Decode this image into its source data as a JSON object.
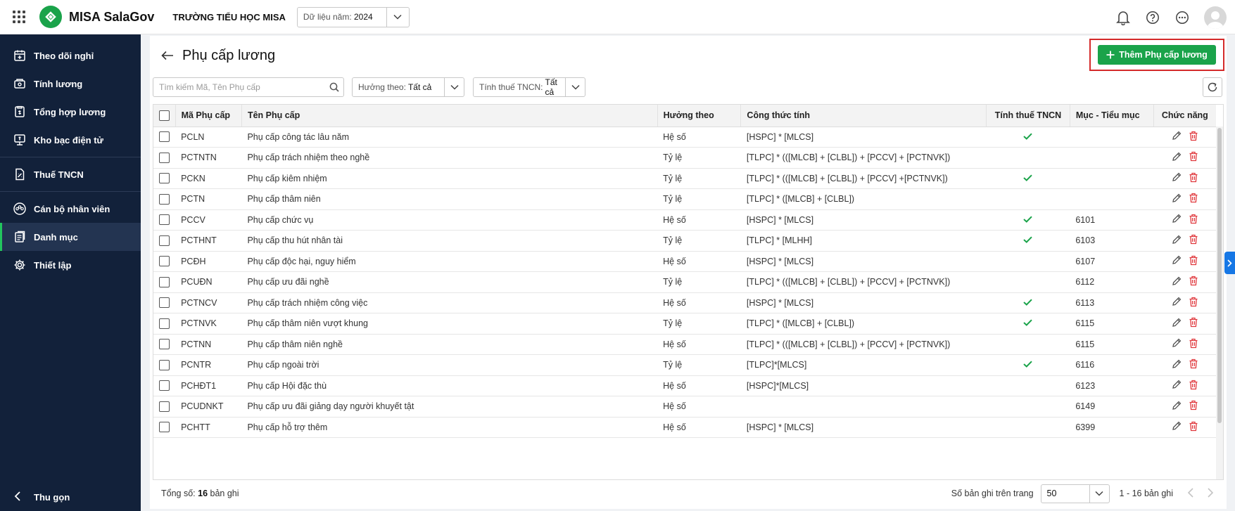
{
  "header": {
    "app_name": "MISA SalaGov",
    "school": "TRƯỜNG TIỂU HỌC MISA",
    "year_label": "Dữ liệu năm:",
    "year_value": "2024"
  },
  "sidebar": {
    "items": [
      {
        "label": "Theo dõi nghỉ",
        "icon": "calendar-icon"
      },
      {
        "label": "Tính lương",
        "icon": "salary-icon"
      },
      {
        "label": "Tổng hợp lương",
        "icon": "summary-icon"
      },
      {
        "label": "Kho bạc điện tử",
        "icon": "treasury-icon"
      },
      {
        "label": "Thuế TNCN",
        "icon": "tax-icon"
      },
      {
        "label": "Cán bộ nhân viên",
        "icon": "staff-icon"
      },
      {
        "label": "Danh mục",
        "icon": "catalog-icon"
      },
      {
        "label": "Thiết lập",
        "icon": "gear-icon"
      }
    ],
    "active_index": 6,
    "collapse_label": "Thu gọn"
  },
  "page": {
    "title": "Phụ cấp lương",
    "add_button": "Thêm Phụ cấp lương",
    "search_placeholder": "Tìm kiếm Mã, Tên Phụ cấp",
    "filter_huong_label": "Hưởng theo:",
    "filter_huong_value": "Tất cả",
    "filter_thue_label": "Tính thuế TNCN:",
    "filter_thue_value": "Tất cả"
  },
  "table": {
    "columns": [
      "Mã Phụ cấp",
      "Tên Phụ cấp",
      "Hưởng theo",
      "Công thức tính",
      "Tính thuế TNCN",
      "Mục - Tiểu mục",
      "Chức năng"
    ],
    "rows": [
      {
        "ma": "PCLN",
        "ten": "Phụ cấp công tác lâu năm",
        "huong": "Hệ số",
        "cong_thuc": "[HSPC] * [MLCS]",
        "thue": true,
        "muc": ""
      },
      {
        "ma": "PCTNTN",
        "ten": "Phụ cấp trách nhiệm theo nghề",
        "huong": "Tỷ lệ",
        "cong_thuc": "[TLPC] * (([MLCB] + [CLBL]) + [PCCV] + [PCTNVK])",
        "thue": false,
        "muc": ""
      },
      {
        "ma": "PCKN",
        "ten": "Phụ cấp kiêm nhiệm",
        "huong": "Tỷ lệ",
        "cong_thuc": "[TLPC] * (([MLCB] + [CLBL]) + [PCCV] +[PCTNVK])",
        "thue": true,
        "muc": ""
      },
      {
        "ma": "PCTN",
        "ten": "Phụ cấp thâm niên",
        "huong": "Tỷ lệ",
        "cong_thuc": "[TLPC] * ([MLCB] + [CLBL])",
        "thue": false,
        "muc": ""
      },
      {
        "ma": "PCCV",
        "ten": "Phụ cấp chức vụ",
        "huong": "Hệ số",
        "cong_thuc": "[HSPC] * [MLCS]",
        "thue": true,
        "muc": "6101"
      },
      {
        "ma": "PCTHNT",
        "ten": "Phụ cấp thu hút nhân tài",
        "huong": "Tỷ lệ",
        "cong_thuc": "[TLPC] * [MLHH]",
        "thue": true,
        "muc": "6103"
      },
      {
        "ma": "PCĐH",
        "ten": "Phụ cấp độc hại, nguy hiểm",
        "huong": "Hệ số",
        "cong_thuc": "[HSPC] * [MLCS]",
        "thue": false,
        "muc": "6107"
      },
      {
        "ma": "PCUĐN",
        "ten": "Phụ cấp ưu đãi nghề",
        "huong": "Tỷ lệ",
        "cong_thuc": "[TLPC] * (([MLCB] + [CLBL]) + [PCCV] + [PCTNVK])",
        "thue": false,
        "muc": "6112"
      },
      {
        "ma": "PCTNCV",
        "ten": "Phụ cấp trách nhiệm công việc",
        "huong": "Hệ số",
        "cong_thuc": "[HSPC] * [MLCS]",
        "thue": true,
        "muc": "6113"
      },
      {
        "ma": "PCTNVK",
        "ten": "Phụ cấp thâm niên vượt khung",
        "huong": "Tỷ lệ",
        "cong_thuc": "[TLPC] * ([MLCB] + [CLBL])",
        "thue": true,
        "muc": "6115"
      },
      {
        "ma": "PCTNN",
        "ten": "Phụ cấp thâm niên nghề",
        "huong": "Hệ số",
        "cong_thuc": "[TLPC] * (([MLCB] + [CLBL]) + [PCCV] + [PCTNVK])",
        "thue": false,
        "muc": "6115"
      },
      {
        "ma": "PCNTR",
        "ten": "Phụ cấp ngoài trời",
        "huong": "Tỷ lệ",
        "cong_thuc": "[TLPC]*[MLCS]",
        "thue": true,
        "muc": "6116"
      },
      {
        "ma": "PCHĐT1",
        "ten": "Phụ cấp Hội đặc thù",
        "huong": "Hệ số",
        "cong_thuc": "[HSPC]*[MLCS]",
        "thue": false,
        "muc": "6123"
      },
      {
        "ma": "PCUDNKT",
        "ten": "Phụ cấp ưu đãi giảng dạy người khuyết tật",
        "huong": "Hệ số",
        "cong_thuc": "",
        "thue": false,
        "muc": "6149"
      },
      {
        "ma": "PCHTT",
        "ten": "Phụ cấp hỗ trợ thêm",
        "huong": "Hệ số",
        "cong_thuc": "[HSPC] * [MLCS]",
        "thue": false,
        "muc": "6399"
      }
    ]
  },
  "footer": {
    "total_label": "Tổng số:",
    "total_value": "16",
    "total_suffix": "bản ghi",
    "per_page_label": "Số bản ghi trên trang",
    "per_page_value": "50",
    "range": "1 - 16 bản ghi"
  },
  "colors": {
    "brand_green": "#1aa34a",
    "sidebar_bg": "#12213a",
    "delete_red": "#e0393e",
    "highlight_border": "#d42a2a"
  }
}
